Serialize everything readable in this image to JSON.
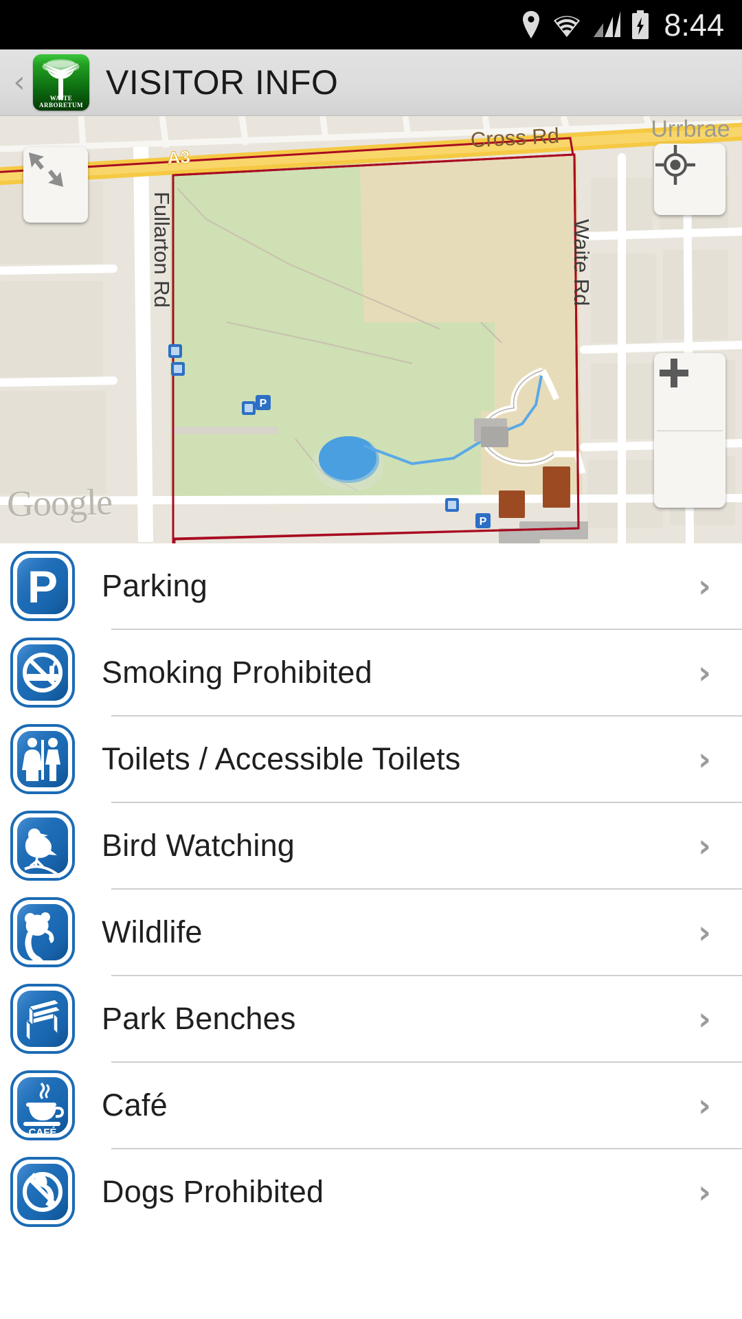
{
  "statusbar": {
    "time": "8:44",
    "icons": [
      "location-pin-icon",
      "wifi-icon",
      "cell-signal-icon",
      "battery-charging-icon"
    ]
  },
  "actionbar": {
    "back_label": "‹",
    "title": "VISITOR INFO",
    "logo": {
      "line1": "WAITE",
      "line2": "ARBORETUM",
      "name": "waite-arboretum-logo"
    }
  },
  "map": {
    "attribution": "Google",
    "controls": {
      "expand": "expand-icon",
      "locate": "my-location-icon",
      "zoom_in": "+",
      "zoom_out": "−"
    },
    "labels": [
      {
        "text": "A3",
        "name": "road-label-a3"
      },
      {
        "text": "Cross Rd",
        "name": "road-label-cross-rd"
      },
      {
        "text": "Urrbrae",
        "name": "place-label-urrbrae"
      },
      {
        "text": "Fullarton Rd",
        "name": "road-label-fullarton-rd"
      },
      {
        "text": "Waite Rd",
        "name": "road-label-waite-rd"
      }
    ],
    "colors": {
      "park_green": "#cfe0b4",
      "field_tan": "#e7dcb9",
      "land": "#e9e5dc",
      "road_yellow": "#f9d449",
      "boundary_red": "#a80b21",
      "water_blue": "#4a9fe0",
      "marker_blue": "#2d6fc4"
    }
  },
  "list": {
    "items": [
      {
        "label": "Parking",
        "icon": "parking-sign-icon"
      },
      {
        "label": "Smoking Prohibited",
        "icon": "no-smoking-sign-icon"
      },
      {
        "label": "Toilets / Accessible Toilets",
        "icon": "toilets-sign-icon"
      },
      {
        "label": "Bird Watching",
        "icon": "bird-sign-icon"
      },
      {
        "label": "Wildlife",
        "icon": "koala-sign-icon"
      },
      {
        "label": "Park Benches",
        "icon": "bench-sign-icon"
      },
      {
        "label": "Café",
        "icon": "cafe-sign-icon"
      },
      {
        "label": "Dogs Prohibited",
        "icon": "no-dogs-sign-icon"
      }
    ],
    "chevron": "›",
    "icon_color": "#1c6bb5"
  }
}
